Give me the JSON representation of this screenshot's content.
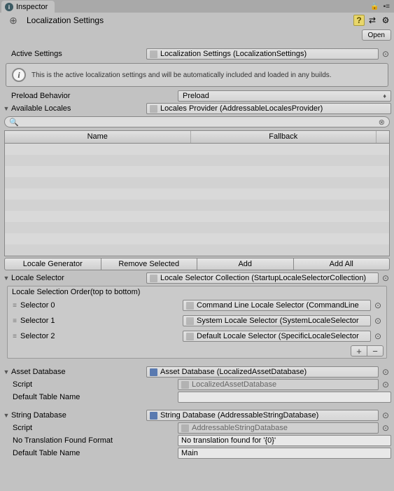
{
  "tab": {
    "title": "Inspector"
  },
  "header": {
    "title": "Localization Settings",
    "open_btn": "Open"
  },
  "active_settings": {
    "label": "Active Settings",
    "value": "Localization Settings (LocalizationSettings)"
  },
  "info": "This is the active localization settings and will be automatically included and loaded in any builds.",
  "preload": {
    "label": "Preload Behavior",
    "value": "Preload"
  },
  "available_locales": {
    "label": "Available Locales",
    "value": "Locales Provider (AddressableLocalesProvider)"
  },
  "list": {
    "col_name": "Name",
    "col_fallback": "Fallback",
    "buttons": {
      "gen": "Locale Generator",
      "rem": "Remove Selected",
      "add": "Add",
      "addall": "Add All"
    }
  },
  "locale_selector": {
    "label": "Locale Selector",
    "value": "Locale Selector Collection (StartupLocaleSelectorCollection)"
  },
  "selection_order_title": "Locale Selection Order(top to bottom)",
  "selectors": [
    {
      "label": "Selector 0",
      "value": "Command Line Locale Selector (CommandLine"
    },
    {
      "label": "Selector 1",
      "value": "System Locale Selector (SystemLocaleSelector"
    },
    {
      "label": "Selector 2",
      "value": "Default Locale Selector (SpecificLocaleSelector"
    }
  ],
  "asset_db": {
    "label": "Asset Database",
    "value": "Asset Database (LocalizedAssetDatabase)",
    "script_label": "Script",
    "script_value": "LocalizedAssetDatabase",
    "table_label": "Default Table Name",
    "table_value": ""
  },
  "string_db": {
    "label": "String Database",
    "value": "String Database (AddressableStringDatabase)",
    "script_label": "Script",
    "script_value": "AddressableStringDatabase",
    "fmt_label": "No Translation Found Format",
    "fmt_value": "No translation found for '{0}'",
    "table_label": "Default Table Name",
    "table_value": "Main"
  }
}
